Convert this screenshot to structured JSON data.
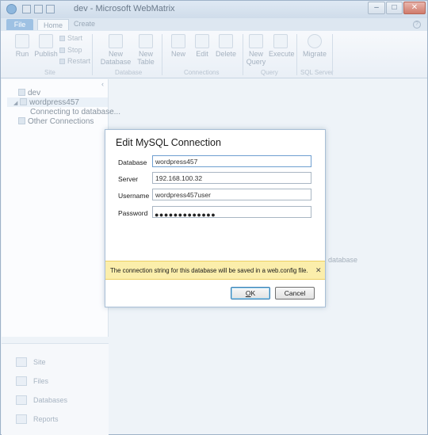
{
  "window": {
    "title": "dev - Microsoft WebMatrix",
    "controls": [
      "–",
      "□",
      "✕"
    ]
  },
  "tabs": {
    "file": "File",
    "home": "Home",
    "other": "Create"
  },
  "ribbon": {
    "site": {
      "run": "Run",
      "publish": "Publish",
      "start": "Start",
      "stop": "Stop",
      "restart": "Restart",
      "label": "Site"
    },
    "database": {
      "new_database": "New Database",
      "new_table": "New Table",
      "label": "Database"
    },
    "connections": {
      "new": "New",
      "edit": "Edit",
      "delete": "Delete",
      "label": "Connections"
    },
    "query": {
      "new_query": "New Query",
      "execute": "Execute",
      "label": "Query"
    },
    "sql_server": {
      "migrate": "Migrate",
      "label": "SQL Server"
    }
  },
  "tree": {
    "root": "dev",
    "connection": "wordpress457",
    "status": "Connecting to database...",
    "other": "Other Connections"
  },
  "nav": [
    "Site",
    "Files",
    "Databases",
    "Reports"
  ],
  "background_text": "database",
  "dialog": {
    "title": "Edit MySQL Connection",
    "fields": {
      "database": {
        "label": "Database",
        "value": "wordpress457"
      },
      "server": {
        "label": "Server",
        "value": "192.168.100.32"
      },
      "username": {
        "label": "Username",
        "value": "wordpress457user"
      },
      "password": {
        "label": "Password",
        "masked": "●●●●●●●●●●●●●"
      }
    },
    "info": "The connection string for this database will be saved in a web.config file.",
    "info_close": "✕",
    "ok_accel": "O",
    "ok_rest": "K",
    "cancel": "Cancel"
  },
  "colors": {
    "info_bar": "#fbeeab",
    "accent": "#9ec1e3"
  }
}
